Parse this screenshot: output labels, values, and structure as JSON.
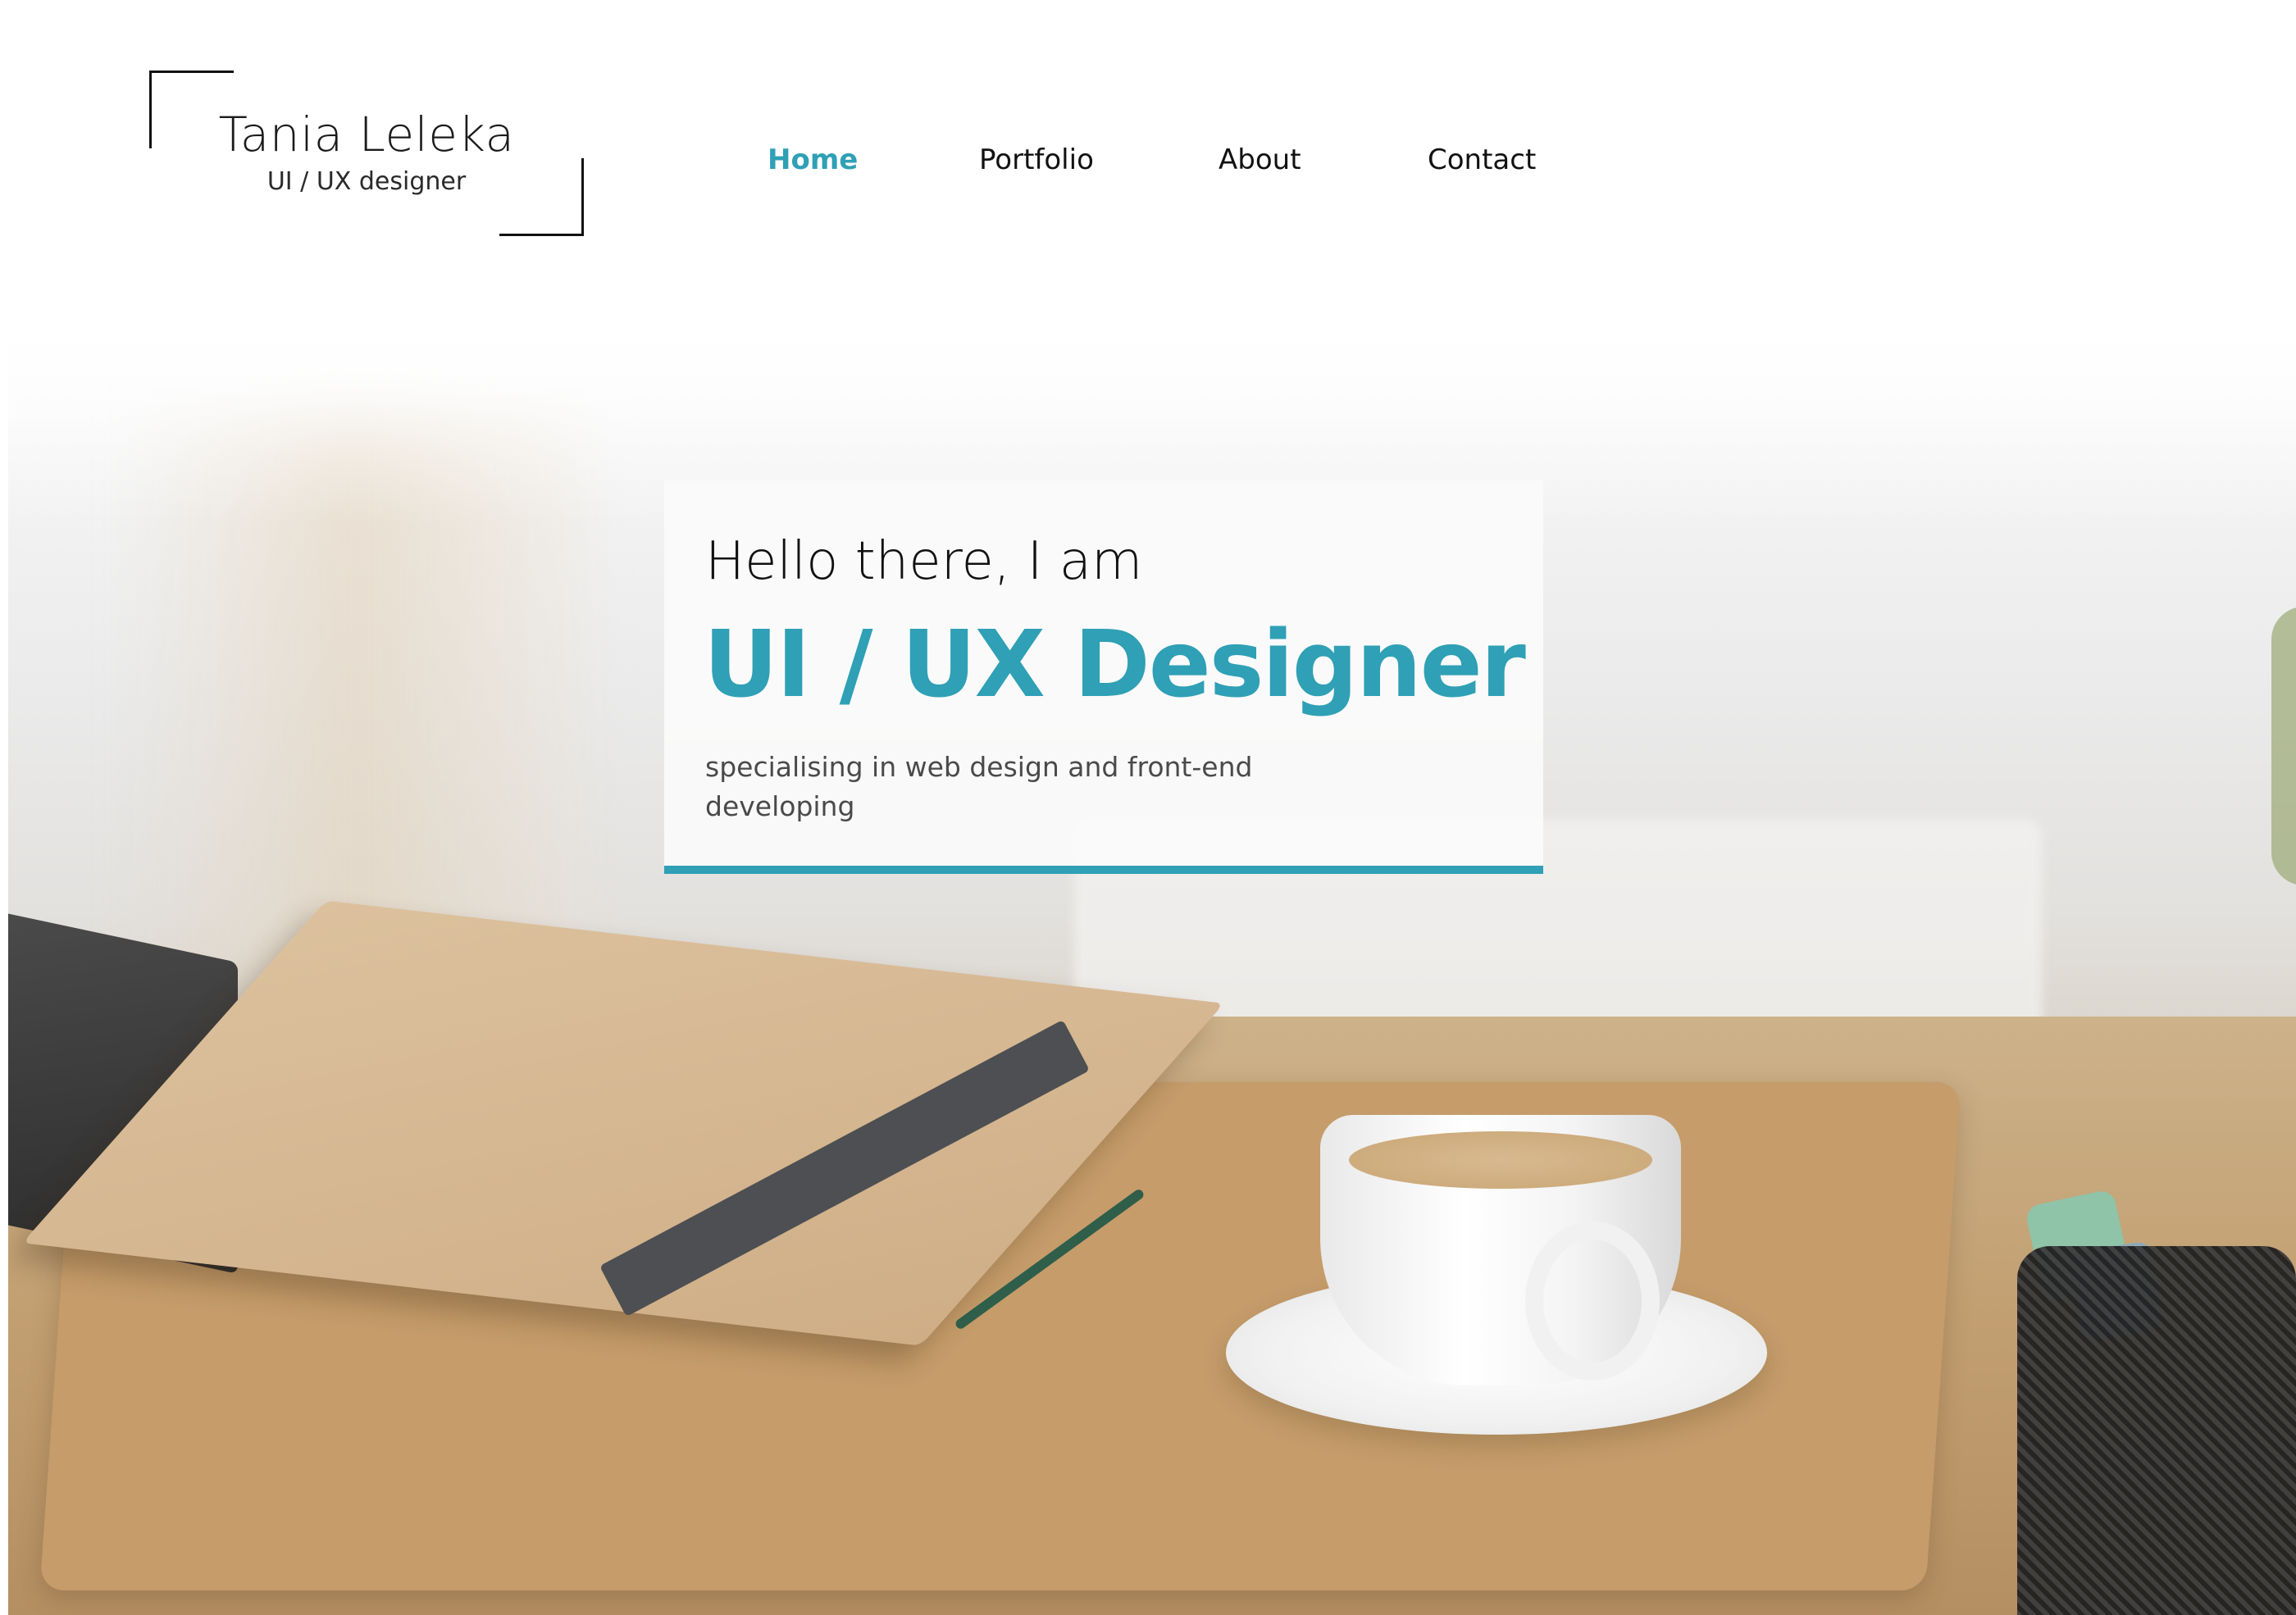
{
  "brand": {
    "name": "Tania Leleka",
    "role": "UI / UX designer"
  },
  "nav": {
    "items": [
      {
        "label": "Home",
        "active": true
      },
      {
        "label": "Portfolio",
        "active": false
      },
      {
        "label": "About",
        "active": false
      },
      {
        "label": "Contact",
        "active": false
      }
    ]
  },
  "hero": {
    "greeting": "Hello there, I am",
    "headline": "UI / UX Designer",
    "tagline": "specialising in web design and front-end developing"
  },
  "colors": {
    "accent": "#2fa0b5",
    "text": "#111111",
    "muted": "#4a4a4a",
    "background": "#ffffff"
  }
}
